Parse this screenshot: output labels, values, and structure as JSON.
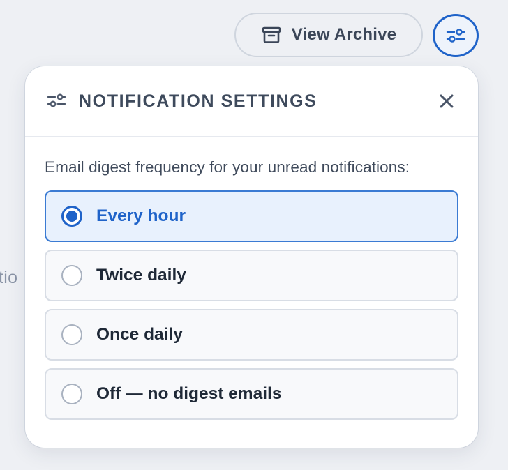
{
  "background": {
    "fragment_text": "tio"
  },
  "toolbar": {
    "archive_icon": "archive-box-icon",
    "archive_label": "View Archive",
    "settings_icon": "sliders-icon"
  },
  "panel": {
    "icon": "sliders-icon",
    "title": "NOTIFICATION SETTINGS",
    "close_icon": "close-icon",
    "prompt": "Email digest frequency for your unread notifications:",
    "options": [
      {
        "label": "Every hour",
        "selected": true
      },
      {
        "label": "Twice daily",
        "selected": false
      },
      {
        "label": "Once daily",
        "selected": false
      },
      {
        "label": "Off — no digest emails",
        "selected": false
      }
    ]
  },
  "colors": {
    "accent": "#1f63c9",
    "selected_bg": "#e8f1fd",
    "background": "#eef0f4"
  }
}
